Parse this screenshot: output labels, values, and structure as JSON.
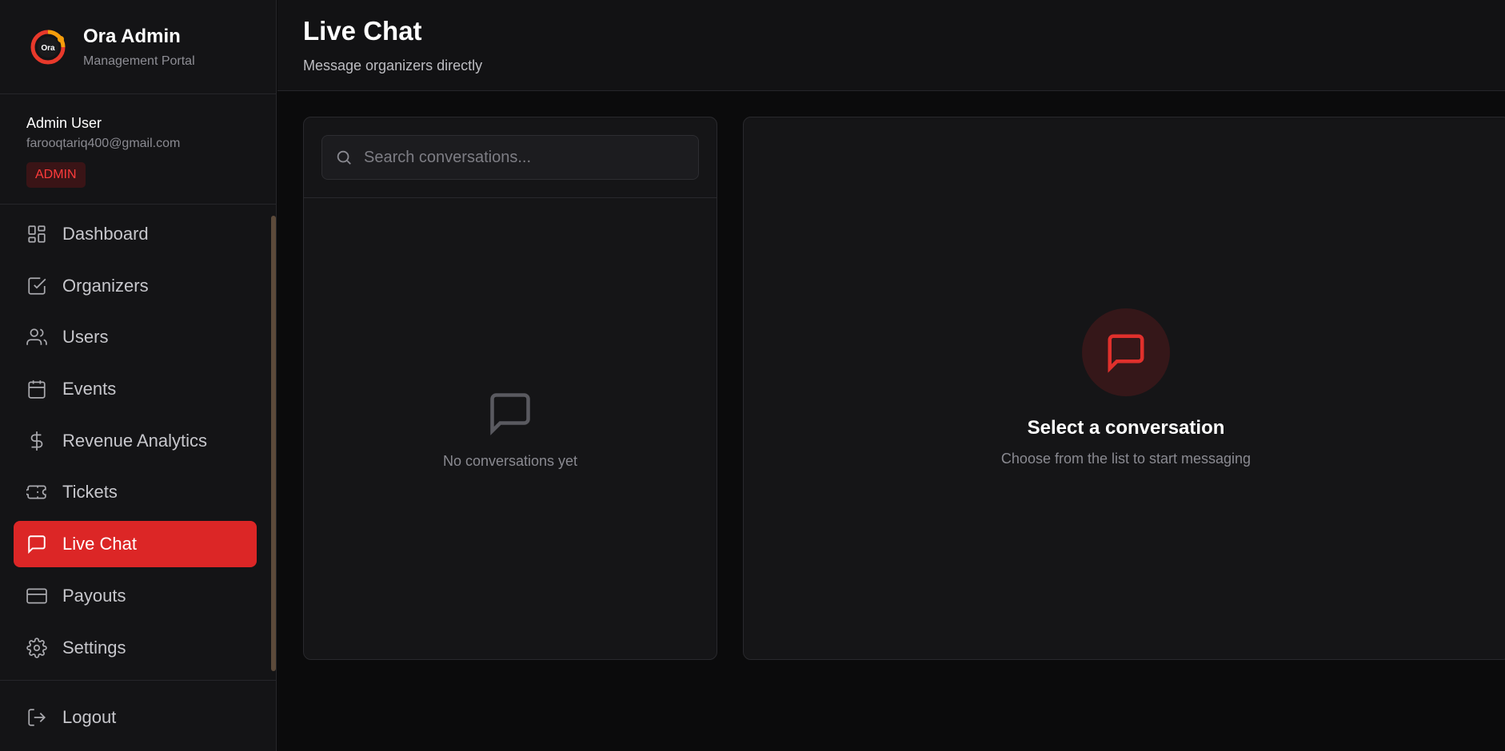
{
  "brand": {
    "title": "Ora Admin",
    "subtitle": "Management Portal",
    "logo_text": "Ora"
  },
  "user": {
    "name": "Admin User",
    "email": "farooqtariq400@gmail.com",
    "role": "ADMIN"
  },
  "nav": {
    "items": [
      {
        "label": "Dashboard",
        "icon": "dashboard-grid-icon",
        "active": false
      },
      {
        "label": "Organizers",
        "icon": "check-square-icon",
        "active": false
      },
      {
        "label": "Users",
        "icon": "users-icon",
        "active": false
      },
      {
        "label": "Events",
        "icon": "calendar-icon",
        "active": false
      },
      {
        "label": "Revenue Analytics",
        "icon": "dollar-icon",
        "active": false
      },
      {
        "label": "Tickets",
        "icon": "ticket-icon",
        "active": false
      },
      {
        "label": "Live Chat",
        "icon": "message-icon",
        "active": true
      },
      {
        "label": "Payouts",
        "icon": "credit-card-icon",
        "active": false
      },
      {
        "label": "Settings",
        "icon": "gear-icon",
        "active": false
      }
    ],
    "logout_label": "Logout"
  },
  "header": {
    "title": "Live Chat",
    "subtitle": "Message organizers directly"
  },
  "conversations": {
    "search_placeholder": "Search conversations...",
    "empty_text": "No conversations yet"
  },
  "chat": {
    "empty_title": "Select a conversation",
    "empty_subtitle": "Choose from the list to start messaging"
  },
  "colors": {
    "accent": "#dc2626",
    "background": "#0b0b0c",
    "panel": "#151517"
  }
}
